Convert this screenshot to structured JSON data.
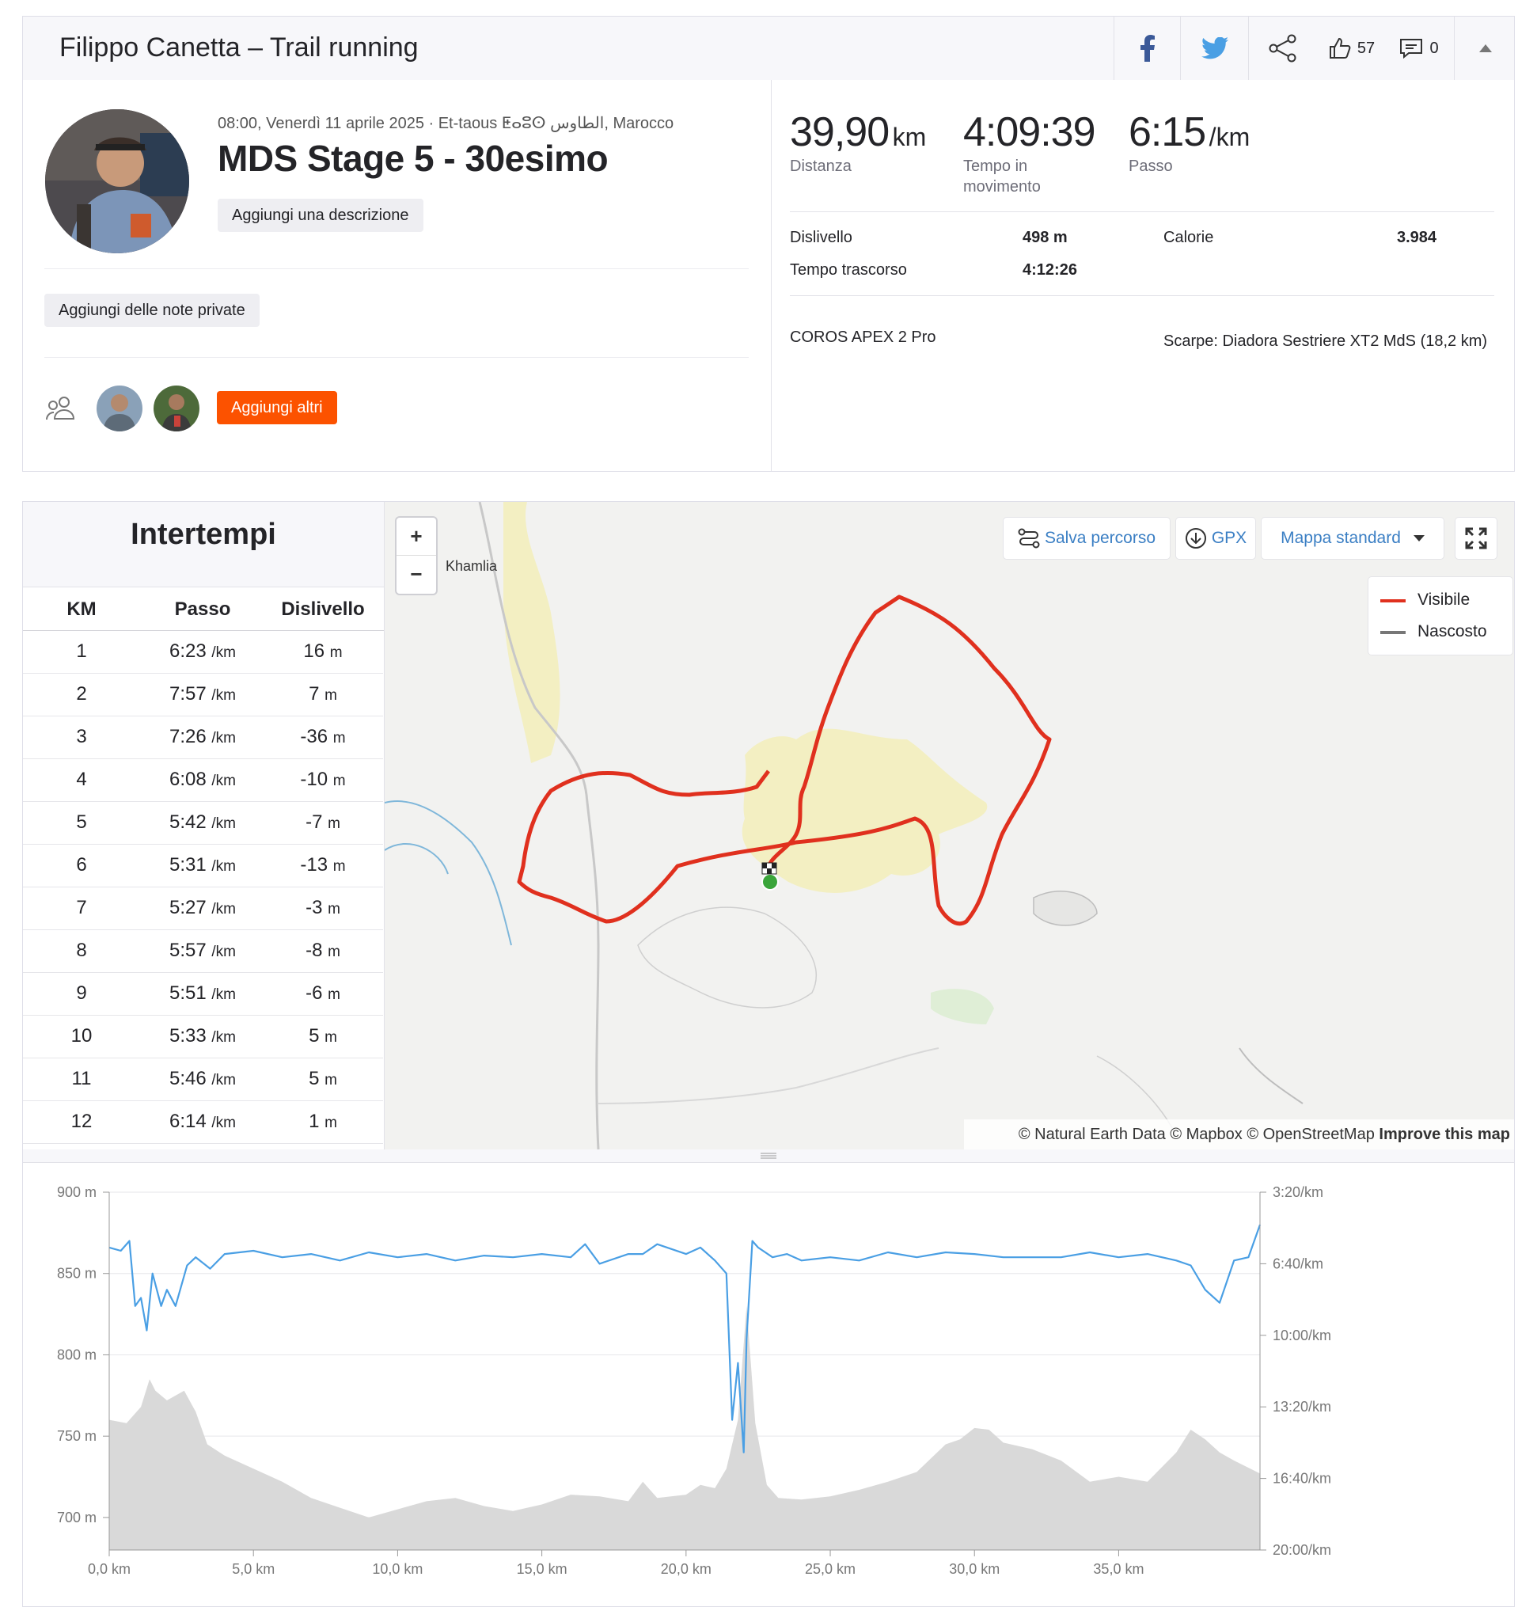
{
  "header": {
    "title": "Filippo Canetta – Trail running",
    "kudos_count": "57",
    "comments_count": "0",
    "colors": {
      "facebook": "#3b5998",
      "twitter": "#4a9fe4"
    }
  },
  "activity": {
    "datetime_location": "08:00, Venerdì 11 aprile 2025 · Et-taous ⵟⴰⵓⵙ الطاوس, Marocco",
    "name": "MDS Stage 5 - 30esimo",
    "add_description": "Aggiungi una descrizione",
    "add_private_notes": "Aggiungi delle note private",
    "add_others": "Aggiungi altri"
  },
  "stats": {
    "distance_value": "39,90",
    "distance_unit": "km",
    "distance_label": "Distanza",
    "moving_time_value": "4:09:39",
    "moving_time_label": "Tempo in movimento",
    "pace_value": "6:15",
    "pace_unit": "/km",
    "pace_label": "Passo",
    "elevation_label": "Dislivello",
    "elevation_value": "498 m",
    "calories_label": "Calorie",
    "calories_value": "3.984",
    "elapsed_label": "Tempo trascorso",
    "elapsed_value": "4:12:26",
    "device": "COROS APEX 2 Pro",
    "shoes": "Scarpe: Diadora Sestriere XT2 MdS (18,2 km)"
  },
  "splits": {
    "title": "Intertempi",
    "headers": [
      "KM",
      "Passo",
      "Dislivello"
    ],
    "pace_unit": "/km",
    "elev_unit": "m",
    "rows": [
      {
        "km": "1",
        "pace": "6:23",
        "elev": "16"
      },
      {
        "km": "2",
        "pace": "7:57",
        "elev": "7"
      },
      {
        "km": "3",
        "pace": "7:26",
        "elev": "-36"
      },
      {
        "km": "4",
        "pace": "6:08",
        "elev": "-10"
      },
      {
        "km": "5",
        "pace": "5:42",
        "elev": "-7"
      },
      {
        "km": "6",
        "pace": "5:31",
        "elev": "-13"
      },
      {
        "km": "7",
        "pace": "5:27",
        "elev": "-3"
      },
      {
        "km": "8",
        "pace": "5:57",
        "elev": "-8"
      },
      {
        "km": "9",
        "pace": "5:51",
        "elev": "-6"
      },
      {
        "km": "10",
        "pace": "5:33",
        "elev": "5"
      },
      {
        "km": "11",
        "pace": "5:46",
        "elev": "5"
      },
      {
        "km": "12",
        "pace": "6:14",
        "elev": "1"
      }
    ]
  },
  "map": {
    "zoom_in": "+",
    "zoom_out": "−",
    "place_label": "Khamlia",
    "save_route": "Salva percorso",
    "gpx": "GPX",
    "map_style": "Mappa standard",
    "legend_visible": "Visibile",
    "legend_hidden": "Nascosto",
    "attribution": "© Natural Earth Data © Mapbox © OpenStreetMap",
    "improve": "Improve this map",
    "route_color": "#e0301e",
    "icons": [
      "plus-icon",
      "minus-icon",
      "route-icon",
      "download-icon",
      "caret-down-icon",
      "fullscreen-icon"
    ]
  },
  "chart_data": {
    "type": "area",
    "x_ticks": [
      "0,0 km",
      "5,0 km",
      "10,0 km",
      "15,0 km",
      "20,0 km",
      "25,0 km",
      "30,0 km",
      "35,0 km"
    ],
    "y_left_ticks": [
      "900 m",
      "850 m",
      "800 m",
      "750 m",
      "700 m"
    ],
    "y_right_ticks": [
      "3:20/km",
      "6:40/km",
      "10:00/km",
      "13:20/km",
      "16:40/km",
      "20:00/km"
    ],
    "xlim": [
      0,
      39.9
    ],
    "ylim_left": [
      680,
      900
    ],
    "series": [
      {
        "kind": "elevation",
        "color": "#d9d9d9",
        "x": [
          0,
          0.6,
          1.1,
          1.4,
          1.6,
          2.0,
          2.6,
          3.0,
          3.4,
          4.0,
          5.0,
          6.0,
          7.0,
          8.0,
          9.0,
          10.0,
          11.0,
          12.0,
          13.0,
          14.0,
          15.0,
          16.0,
          17.0,
          18.0,
          18.5,
          19.0,
          20.0,
          20.5,
          21.0,
          21.4,
          21.8,
          22.1,
          22.4,
          22.8,
          23.2,
          24.0,
          25.0,
          26.0,
          27.0,
          28.0,
          29.0,
          29.5,
          30.0,
          30.5,
          31.0,
          32.0,
          33.0,
          34.0,
          35.0,
          36.0,
          37.0,
          37.5,
          38.0,
          38.5,
          39.0,
          39.9
        ],
        "y": [
          760,
          758,
          768,
          785,
          778,
          772,
          778,
          765,
          745,
          738,
          730,
          722,
          712,
          706,
          700,
          705,
          710,
          712,
          707,
          704,
          708,
          714,
          713,
          710,
          722,
          712,
          714,
          720,
          718,
          730,
          760,
          830,
          758,
          720,
          712,
          711,
          713,
          717,
          722,
          728,
          745,
          748,
          755,
          754,
          746,
          742,
          735,
          722,
          725,
          722,
          740,
          754,
          748,
          740,
          735,
          727
        ]
      },
      {
        "kind": "pace",
        "color": "#4a9fe4",
        "x": [
          0,
          0.4,
          0.7,
          0.9,
          1.1,
          1.3,
          1.5,
          1.8,
          2.0,
          2.3,
          2.7,
          3.0,
          3.5,
          4.0,
          5.0,
          6.0,
          7.0,
          8.0,
          9.0,
          10.0,
          11.0,
          12.0,
          13.0,
          14.0,
          15.0,
          16.0,
          16.5,
          17.0,
          18.0,
          18.5,
          19.0,
          20.0,
          20.5,
          21.0,
          21.4,
          21.6,
          21.8,
          22.0,
          22.1,
          22.3,
          22.5,
          23.0,
          23.5,
          24.0,
          25.0,
          26.0,
          27.0,
          28.0,
          29.0,
          30.0,
          31.0,
          32.0,
          33.0,
          34.0,
          35.0,
          36.0,
          37.0,
          37.5,
          38.0,
          38.5,
          39.0,
          39.5,
          39.9
        ],
        "y": [
          866,
          864,
          870,
          830,
          835,
          815,
          850,
          830,
          840,
          830,
          855,
          860,
          853,
          862,
          864,
          860,
          862,
          858,
          863,
          860,
          862,
          858,
          861,
          860,
          862,
          860,
          868,
          856,
          862,
          862,
          868,
          862,
          866,
          858,
          850,
          760,
          795,
          740,
          810,
          870,
          866,
          860,
          862,
          858,
          860,
          858,
          863,
          860,
          863,
          862,
          860,
          860,
          860,
          863,
          860,
          862,
          858,
          855,
          840,
          832,
          858,
          860,
          880
        ]
      }
    ]
  }
}
